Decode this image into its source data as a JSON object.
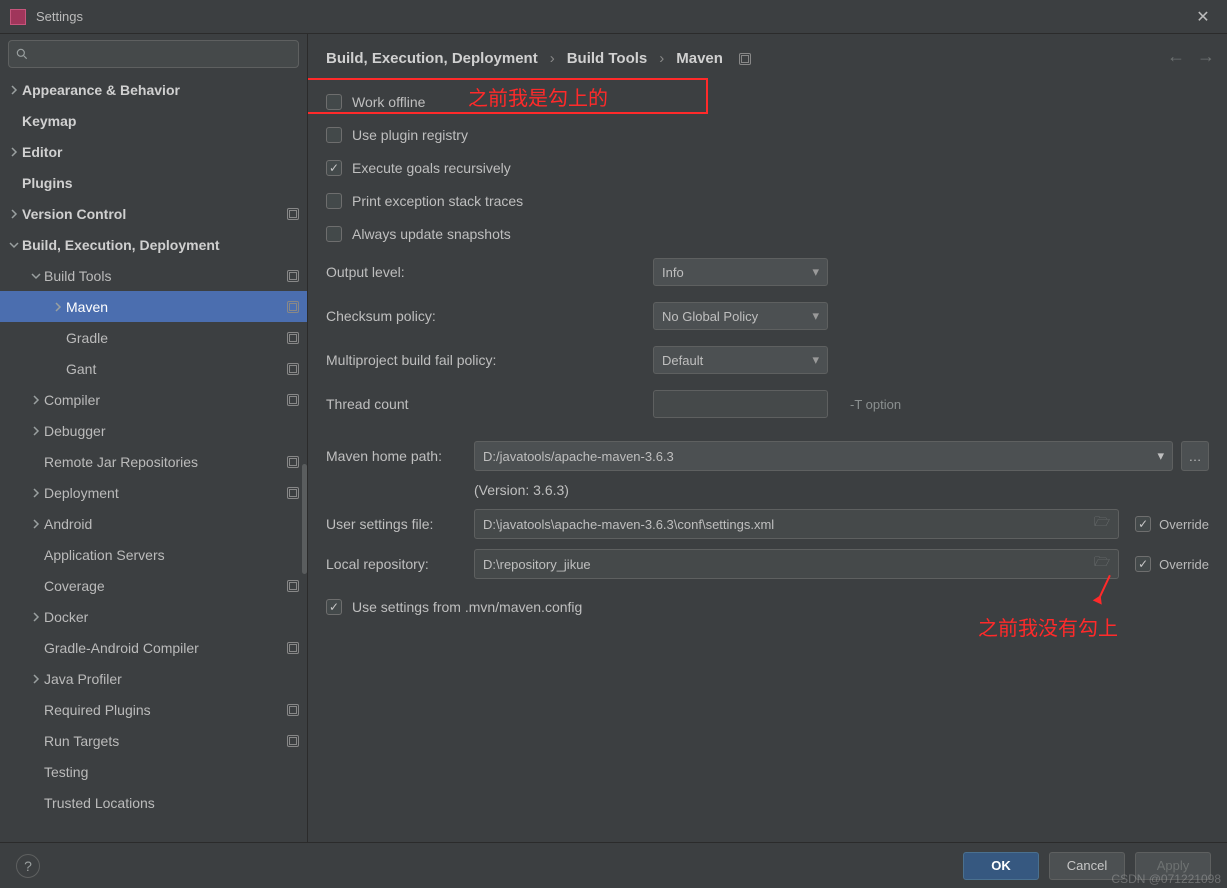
{
  "window": {
    "title": "Settings"
  },
  "sidebar": {
    "search_placeholder": "",
    "items": [
      {
        "label": "Appearance & Behavior",
        "indent": 0,
        "arrow": "right",
        "bold": true,
        "badge": false
      },
      {
        "label": "Keymap",
        "indent": 0,
        "arrow": "none",
        "bold": true,
        "badge": false
      },
      {
        "label": "Editor",
        "indent": 0,
        "arrow": "right",
        "bold": true,
        "badge": false
      },
      {
        "label": "Plugins",
        "indent": 0,
        "arrow": "none",
        "bold": true,
        "badge": false
      },
      {
        "label": "Version Control",
        "indent": 0,
        "arrow": "right",
        "bold": true,
        "badge": true
      },
      {
        "label": "Build, Execution, Deployment",
        "indent": 0,
        "arrow": "down",
        "bold": true,
        "badge": false
      },
      {
        "label": "Build Tools",
        "indent": 1,
        "arrow": "down",
        "bold": false,
        "badge": true
      },
      {
        "label": "Maven",
        "indent": 2,
        "arrow": "right",
        "bold": false,
        "badge": true,
        "selected": true
      },
      {
        "label": "Gradle",
        "indent": 2,
        "arrow": "none",
        "bold": false,
        "badge": true
      },
      {
        "label": "Gant",
        "indent": 2,
        "arrow": "none",
        "bold": false,
        "badge": true
      },
      {
        "label": "Compiler",
        "indent": 1,
        "arrow": "right",
        "bold": false,
        "badge": true
      },
      {
        "label": "Debugger",
        "indent": 1,
        "arrow": "right",
        "bold": false,
        "badge": false
      },
      {
        "label": "Remote Jar Repositories",
        "indent": 1,
        "arrow": "none",
        "bold": false,
        "badge": true
      },
      {
        "label": "Deployment",
        "indent": 1,
        "arrow": "right",
        "bold": false,
        "badge": true
      },
      {
        "label": "Android",
        "indent": 1,
        "arrow": "right",
        "bold": false,
        "badge": false
      },
      {
        "label": "Application Servers",
        "indent": 1,
        "arrow": "none",
        "bold": false,
        "badge": false
      },
      {
        "label": "Coverage",
        "indent": 1,
        "arrow": "none",
        "bold": false,
        "badge": true
      },
      {
        "label": "Docker",
        "indent": 1,
        "arrow": "right",
        "bold": false,
        "badge": false
      },
      {
        "label": "Gradle-Android Compiler",
        "indent": 1,
        "arrow": "none",
        "bold": false,
        "badge": true
      },
      {
        "label": "Java Profiler",
        "indent": 1,
        "arrow": "right",
        "bold": false,
        "badge": false
      },
      {
        "label": "Required Plugins",
        "indent": 1,
        "arrow": "none",
        "bold": false,
        "badge": true
      },
      {
        "label": "Run Targets",
        "indent": 1,
        "arrow": "none",
        "bold": false,
        "badge": true
      },
      {
        "label": "Testing",
        "indent": 1,
        "arrow": "none",
        "bold": false,
        "badge": false
      },
      {
        "label": "Trusted Locations",
        "indent": 1,
        "arrow": "none",
        "bold": false,
        "badge": false
      }
    ]
  },
  "breadcrumb": {
    "p0": "Build, Execution, Deployment",
    "p1": "Build Tools",
    "p2": "Maven"
  },
  "checkboxes": {
    "work_offline": {
      "label": "Work offline",
      "checked": false
    },
    "plugin_registry": {
      "label": "Use plugin registry",
      "checked": false
    },
    "exec_recursive": {
      "label": "Execute goals recursively",
      "checked": true
    },
    "print_stack": {
      "label": "Print exception stack traces",
      "checked": false
    },
    "always_update": {
      "label": "Always update snapshots",
      "checked": false
    },
    "use_mvn_config": {
      "label": "Use settings from .mvn/maven.config",
      "checked": true
    }
  },
  "fields": {
    "output_level": {
      "label": "Output level:",
      "value": "Info"
    },
    "checksum_policy": {
      "label": "Checksum policy:",
      "value": "No Global Policy"
    },
    "fail_policy": {
      "label": "Multiproject build fail policy:",
      "value": "Default"
    },
    "thread_count": {
      "label": "Thread count",
      "value": "",
      "hint": "-T option"
    }
  },
  "paths": {
    "home": {
      "label": "Maven home path:",
      "value": "D:/javatools/apache-maven-3.6.3"
    },
    "version": "(Version: 3.6.3)",
    "settings": {
      "label": "User settings file:",
      "value": "D:\\javatools\\apache-maven-3.6.3\\conf\\settings.xml",
      "override_label": "Override",
      "override": true
    },
    "repo": {
      "label": "Local repository:",
      "value": "D:\\repository_jikue",
      "override_label": "Override",
      "override": true
    }
  },
  "annotations": {
    "a1": "之前我是勾上的",
    "a2": "之前我没有勾上"
  },
  "footer": {
    "ok": "OK",
    "cancel": "Cancel",
    "apply": "Apply"
  },
  "watermark": "CSDN @071221098"
}
